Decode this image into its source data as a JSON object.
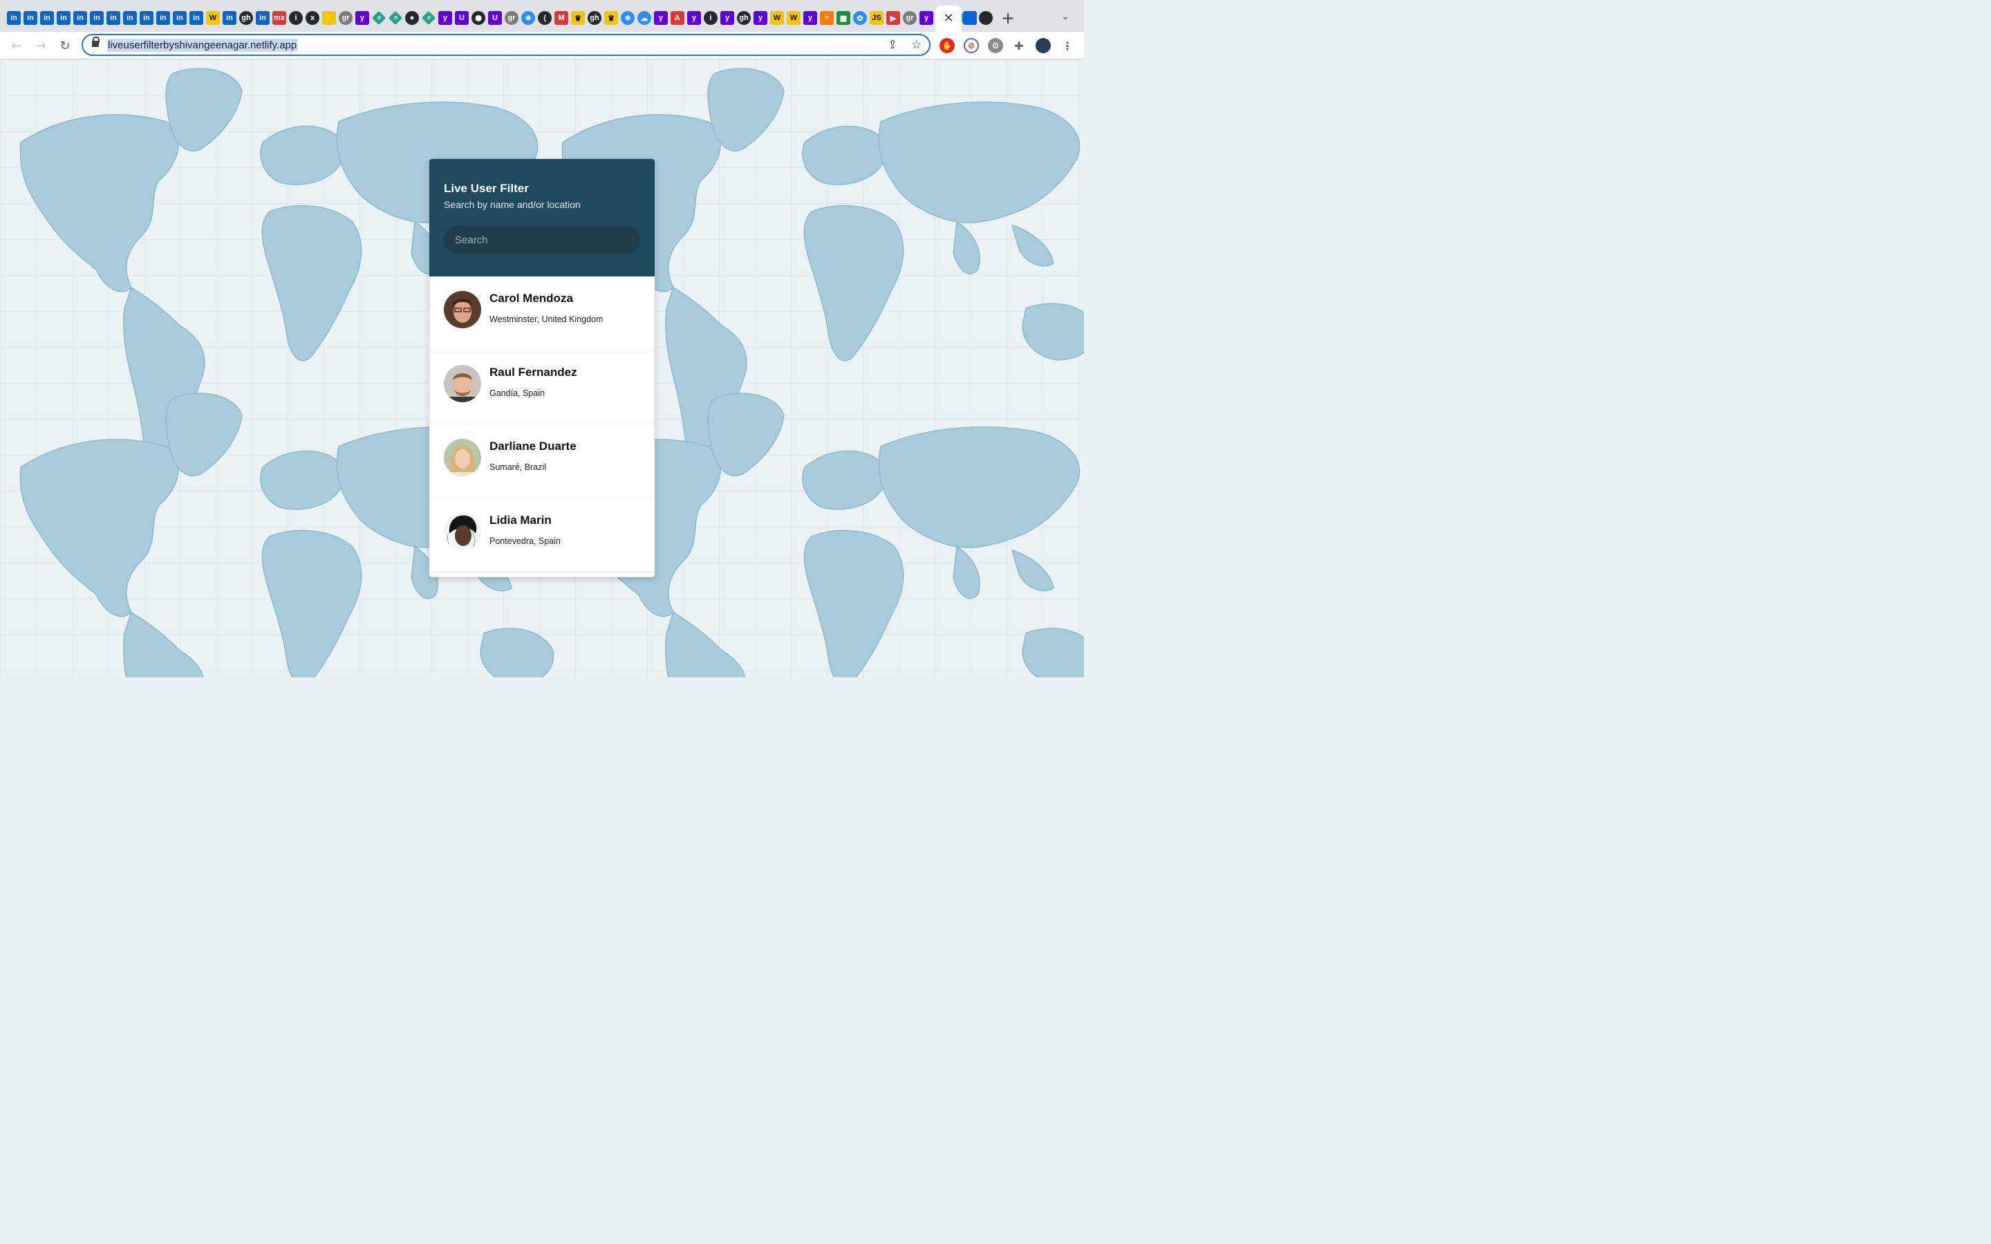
{
  "browser": {
    "url": "liveuserfilterbyshivangeenagar.netlify.app",
    "tab_close_glyph": "✕",
    "new_tab_glyph": "+",
    "tab_favicons": [
      "in",
      "in",
      "in",
      "in",
      "in",
      "in",
      "in",
      "in",
      "in",
      "in",
      "in",
      "in",
      "W",
      "in",
      "gh",
      "in",
      "mx",
      "i",
      "x",
      "⚡",
      "gr",
      "y",
      "tl",
      "tl",
      "●",
      "tl",
      "y",
      "U",
      "⬢",
      "U",
      "gr",
      "⚛",
      "⟨",
      "M",
      "♛",
      "gh",
      "♛",
      "⚛",
      "☁",
      "y",
      "Ⲁ",
      "y",
      "i",
      "y",
      "gh",
      "y",
      "W",
      "W",
      "y",
      "≡",
      "▦",
      "✿",
      "JS",
      "▶",
      "gr",
      "y",
      "y",
      "tl"
    ]
  },
  "app": {
    "title": "Live User Filter",
    "subtitle": "Search by name and/or location",
    "search_placeholder": "Search"
  },
  "users": [
    {
      "name": "Carol Mendoza",
      "location": "Westminster, United Kingdom"
    },
    {
      "name": "Raul Fernandez",
      "location": "Gandía, Spain"
    },
    {
      "name": "Darliane Duarte",
      "location": "Sumaré, Brazil"
    },
    {
      "name": "Lidia Marin",
      "location": "Pontevedra, Spain"
    }
  ],
  "colors": {
    "header_bg": "#21495e",
    "search_bg": "#1f3c4b",
    "map_ocean": "#eaf2f6",
    "map_land": "#a8cad9"
  }
}
